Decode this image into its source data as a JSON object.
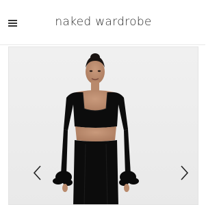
{
  "header": {
    "brand": "naked wardrobe",
    "menu_icon": "hamburger-menu-icon"
  },
  "gallery": {
    "prev_icon": "chevron-left-icon",
    "next_icon": "chevron-right-icon"
  },
  "colors": {
    "background": "#ffffff",
    "photo_backdrop": "#eeeeee",
    "garment": "#0c0c0c",
    "text": "#2a2a2a"
  }
}
